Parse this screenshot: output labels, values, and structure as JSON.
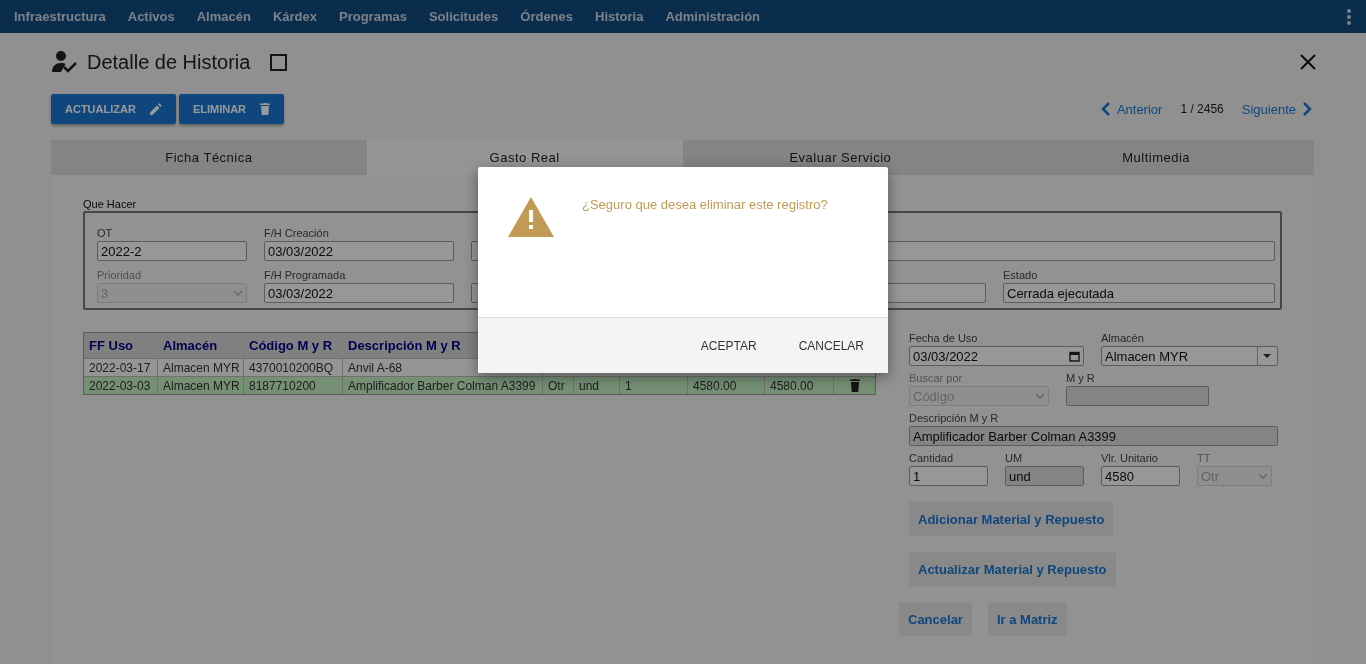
{
  "nav": {
    "items": [
      "Infraestructura",
      "Activos",
      "Almacén",
      "Kárdex",
      "Programas",
      "Solicitudes",
      "Órdenes",
      "Historia",
      "Administración"
    ]
  },
  "header": {
    "title": "Detalle de Historia",
    "checked": false
  },
  "actions": [
    {
      "label": "ACTUALIZAR",
      "kind": "edit"
    },
    {
      "label": "ELIMINAR",
      "kind": "delete"
    }
  ],
  "pager": {
    "previous": "Anterior",
    "count": "1 / 2456",
    "next": "Siguiente"
  },
  "tabs": [
    {
      "label": "Ficha Técnica",
      "selected": false
    },
    {
      "label": "Gasto Real",
      "selected": true
    },
    {
      "label": "Evaluar Servicio",
      "selected": false
    },
    {
      "label": "Multimedia",
      "selected": false
    }
  ],
  "que_hacer": {
    "legend": "Que Hacer",
    "fields": [
      {
        "label": "OT",
        "value": "2022-2",
        "kind": "text",
        "disabled": false
      },
      {
        "label": "F/H Creación",
        "value": "03/03/2022",
        "kind": "text",
        "disabled": false
      },
      {
        "kind": "text",
        "disabled": false
      },
      {
        "label": "Prioridad",
        "value": "3",
        "kind": "select",
        "disabled": true
      },
      {
        "label": "F/H Programada",
        "value": "03/03/2022",
        "kind": "text",
        "disabled": false
      },
      {
        "kind": "text",
        "disabled": false
      },
      {
        "kind": "text",
        "disabled": false
      },
      {
        "label": "Estado",
        "value": "Cerrada ejecutada",
        "kind": "text",
        "disabled": false
      }
    ]
  },
  "table": {
    "columns": [
      "FF Uso",
      "Almacén",
      "Código M y R",
      "Descripción M y R"
    ],
    "rows": [
      {
        "selected": false,
        "cells": [
          "2022-03-17",
          "Almacen MYR",
          "4370010200BQ",
          "Anvil A-68"
        ]
      },
      {
        "selected": true,
        "cells": [
          "2022-03-03",
          "Almacen MYR",
          "8187710200",
          "Amplificador Barber Colman A3399",
          "Otr",
          "und",
          "1",
          "4580.00",
          "4580.00"
        ]
      }
    ]
  },
  "form": {
    "fields": [
      {
        "label": "Fecha de Uso",
        "value": "03/03/2022",
        "kind": "date",
        "disabled": false
      },
      {
        "label": "Almacén",
        "value": "Almacen MYR",
        "kind": "dropdown",
        "disabled": false
      },
      {
        "label": "Buscar por",
        "value": "Código",
        "kind": "select",
        "disabled": true
      },
      {
        "label": "M y R",
        "kind": "readonly",
        "disabled": false
      },
      {
        "label": "Descripción M y R",
        "value": "Amplificador Barber Colman A3399",
        "kind": "readonly",
        "disabled": false
      },
      {
        "label": "Cantidad",
        "value": "1",
        "kind": "text",
        "disabled": false
      },
      {
        "label": "UM",
        "value": "und",
        "kind": "readonly",
        "disabled": false
      },
      {
        "label": "Vlr. Unitario",
        "value": "4580",
        "kind": "text",
        "disabled": false
      },
      {
        "label": "TT",
        "value": "Otr",
        "kind": "select",
        "disabled": true
      }
    ],
    "buttons": [
      "Adicionar Material y Repuesto",
      "Actualizar Material y Repuesto"
    ],
    "footer_buttons": [
      "Cancelar",
      "Ir a Matriz"
    ]
  },
  "dialog": {
    "message": "¿Seguro que desea eliminar este registro?",
    "buttons": [
      "ACEPTAR",
      "CANCELAR"
    ]
  }
}
